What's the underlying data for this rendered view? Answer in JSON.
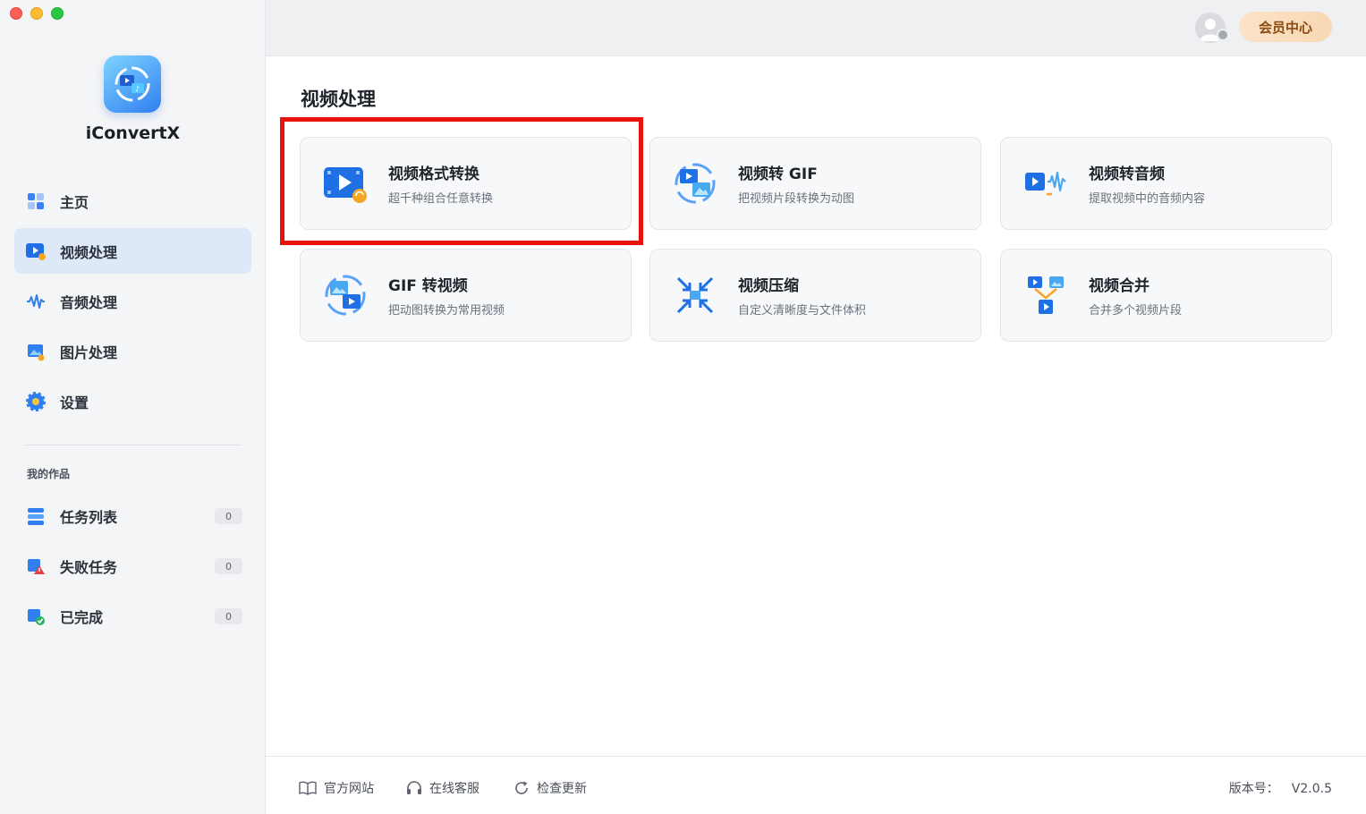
{
  "app": {
    "name": "iConvertX"
  },
  "sidebar": {
    "items": [
      {
        "label": "主页",
        "icon": "home-grid-icon"
      },
      {
        "label": "视频处理",
        "icon": "video-process-icon",
        "active": true
      },
      {
        "label": "音频处理",
        "icon": "audio-wave-icon"
      },
      {
        "label": "图片处理",
        "icon": "image-process-icon"
      },
      {
        "label": "设置",
        "icon": "gear-icon"
      }
    ],
    "works_title": "我的作品",
    "works": [
      {
        "label": "任务列表",
        "count": "0",
        "icon": "task-list-icon"
      },
      {
        "label": "失败任务",
        "count": "0",
        "icon": "failed-task-icon"
      },
      {
        "label": "已完成",
        "count": "0",
        "icon": "completed-icon"
      }
    ]
  },
  "header": {
    "member_label": "会员中心"
  },
  "main": {
    "title": "视频处理",
    "cards": [
      {
        "title": "视频格式转换",
        "subtitle": "超千种组合任意转换",
        "icon": "video-convert-icon"
      },
      {
        "title": "视频转 GIF",
        "subtitle": "把视频片段转换为动图",
        "icon": "video-to-gif-icon"
      },
      {
        "title": "视频转音频",
        "subtitle": "提取视频中的音频内容",
        "icon": "video-to-audio-icon"
      },
      {
        "title": "GIF 转视频",
        "subtitle": "把动图转换为常用视频",
        "icon": "gif-to-video-icon"
      },
      {
        "title": "视频压缩",
        "subtitle": "自定义清晰度与文件体积",
        "icon": "compress-icon"
      },
      {
        "title": "视频合并",
        "subtitle": "合并多个视频片段",
        "icon": "merge-icon"
      }
    ]
  },
  "footer": {
    "website": "官方网站",
    "support": "在线客服",
    "update": "检查更新",
    "version_label": "版本号：",
    "version_value": "V2.0.5"
  },
  "colors": {
    "accent": "#2f7ff0",
    "highlight": "#e8140c",
    "active_bg": "#dde8f8"
  }
}
